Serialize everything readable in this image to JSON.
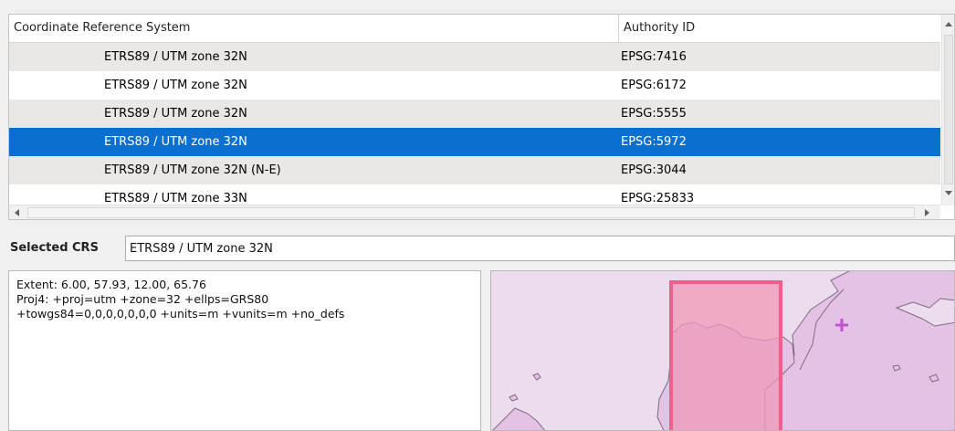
{
  "table": {
    "headers": {
      "crs": "Coordinate Reference System",
      "authority": "Authority ID"
    },
    "rows": [
      {
        "name": "ETRS89 / UTM zone 32N",
        "authority": "EPSG:7416",
        "selected": false
      },
      {
        "name": "ETRS89 / UTM zone 32N",
        "authority": "EPSG:6172",
        "selected": false
      },
      {
        "name": "ETRS89 / UTM zone 32N",
        "authority": "EPSG:5555",
        "selected": false
      },
      {
        "name": "ETRS89 / UTM zone 32N",
        "authority": "EPSG:5972",
        "selected": true
      },
      {
        "name": "ETRS89 / UTM zone 32N (N-E)",
        "authority": "EPSG:3044",
        "selected": false
      },
      {
        "name": "ETRS89 / UTM zone 33N",
        "authority": "EPSG:25833",
        "selected": false
      }
    ]
  },
  "selected_crs": {
    "label": "Selected CRS",
    "value": "ETRS89 / UTM zone 32N"
  },
  "info": {
    "extent": "Extent: 6.00, 57.93, 12.00, 65.76",
    "proj4_line1": "Proj4: +proj=utm +zone=32 +ellps=GRS80",
    "proj4_line2": "+towgs84=0,0,0,0,0,0,0 +units=m +vunits=m +no_defs"
  },
  "colors": {
    "selection": "#0a6fce",
    "map_ocean": "#eddbee",
    "map_land": "#e4c2e6",
    "extent_fill": "#f09ab8",
    "extent_border": "#ee5f8e",
    "center_marker": "#c34fd2"
  },
  "icons": {
    "center_marker": "plus-marker-icon"
  }
}
